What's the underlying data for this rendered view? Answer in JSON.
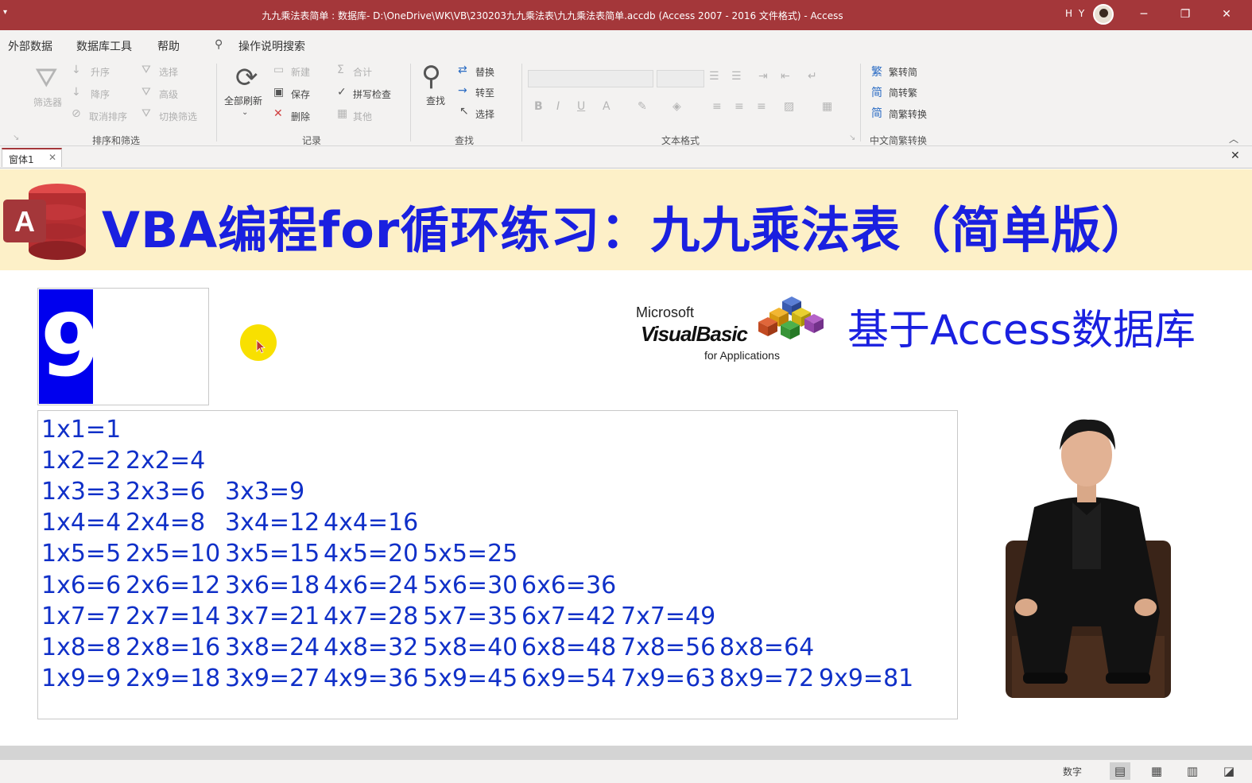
{
  "window": {
    "title": "九九乘法表简单 : 数据库- D:\\OneDrive\\WK\\VB\\230203九九乘法表\\九九乘法表简单.accdb (Access 2007 - 2016 文件格式)  -  Access",
    "user_initials": "H Y",
    "quick_access": "▾",
    "minimize": "─",
    "restore": "❐",
    "close": "✕"
  },
  "menu": [
    "外部数据",
    "数据库工具",
    "帮助",
    "操作说明搜索"
  ],
  "ribbon": {
    "sort_filter": {
      "filter": "筛选器",
      "asc": "升序",
      "desc": "降序",
      "remove_sort": "取消排序",
      "selection": "选择",
      "advanced": "高级",
      "toggle_filter": "切换筛选",
      "group": "排序和筛选"
    },
    "records": {
      "refresh_all": "全部刷新",
      "new": "新建",
      "save": "保存",
      "delete": "删除",
      "totals": "合计",
      "spelling": "拼写检查",
      "more": "其他",
      "group": "记录"
    },
    "find": {
      "find": "查找",
      "replace": "替换",
      "goto": "转至",
      "select": "选择",
      "group": "查找"
    },
    "text_format": {
      "group": "文本格式"
    },
    "chinese": {
      "t2s": "繁转简",
      "s2t": "简转繁",
      "convert": "简繁转换",
      "group": "中文简繁转换"
    }
  },
  "doc_tab": "窗体1",
  "form": {
    "header_title": "VBA编程for循环练习：九九乘法表（简单版）",
    "number_value": "9",
    "vba_logo": {
      "microsoft": "Microsoft",
      "visual_basic": "VisualBasic",
      "for_apps": "for Applications"
    },
    "based_on": "基于Access数据库",
    "table_rows": [
      [
        "1x1=1"
      ],
      [
        "1x2=2",
        "2x2=4"
      ],
      [
        "1x3=3",
        "2x3=6",
        "3x3=9"
      ],
      [
        "1x4=4",
        "2x4=8",
        "3x4=12",
        "4x4=16"
      ],
      [
        "1x5=5",
        "2x5=10",
        "3x5=15",
        "4x5=20",
        "5x5=25"
      ],
      [
        "1x6=6",
        "2x6=12",
        "3x6=18",
        "4x6=24",
        "5x6=30",
        "6x6=36"
      ],
      [
        "1x7=7",
        "2x7=14",
        "3x7=21",
        "4x7=28",
        "5x7=35",
        "6x7=42",
        "7x7=49"
      ],
      [
        "1x8=8",
        "2x8=16",
        "3x8=24",
        "4x8=32",
        "5x8=40",
        "6x8=48",
        "7x8=56",
        "8x8=64"
      ],
      [
        "1x9=9",
        "2x9=18",
        "3x9=27",
        "4x9=36",
        "5x9=45",
        "6x9=54",
        "7x9=63",
        "8x9=72",
        "9x9=81"
      ]
    ]
  },
  "status": {
    "mode": "数字"
  },
  "colors": {
    "titlebar": "#a4373a",
    "header_bg": "#fdf0c8",
    "title_blue": "#1a20e0",
    "table_text": "#1030c8",
    "selection_blue": "#0000ee"
  }
}
